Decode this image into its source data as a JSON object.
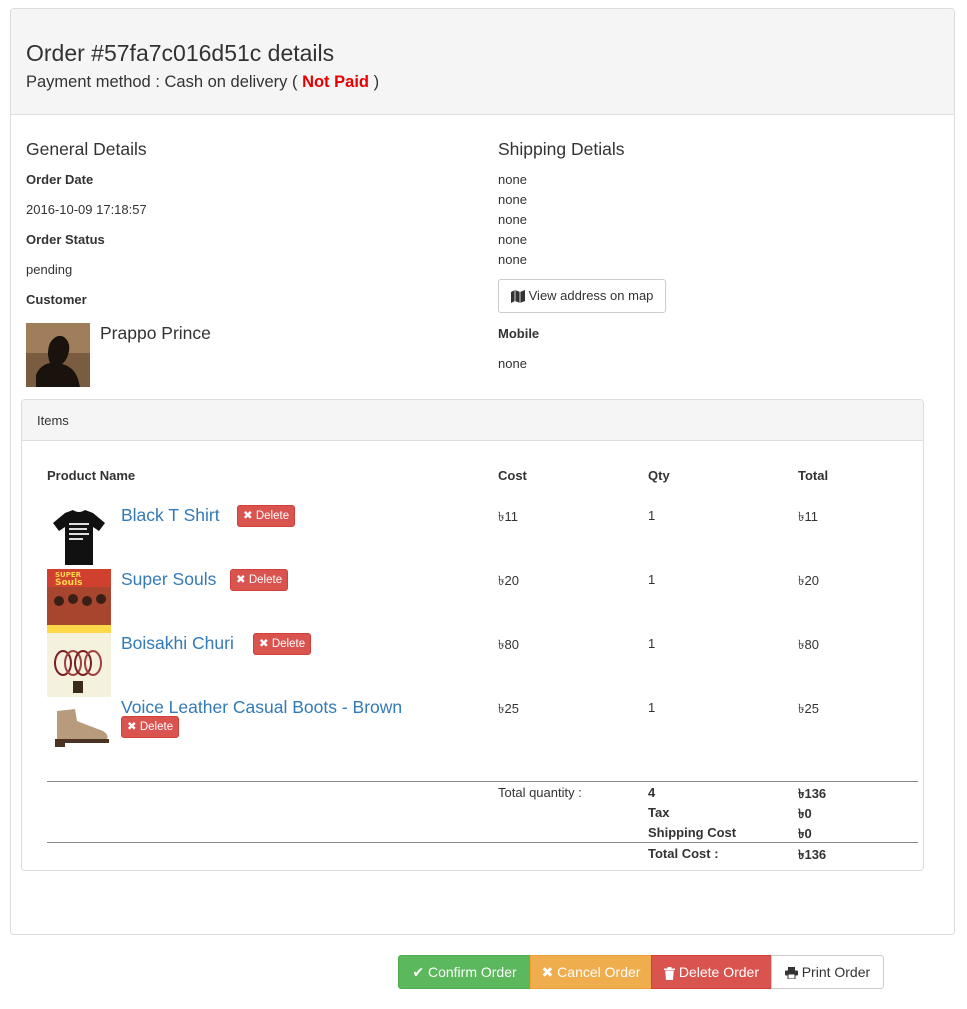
{
  "header": {
    "title": "Order #57fa7c016d51c details",
    "payment_prefix": "Payment method : Cash on delivery (",
    "payment_status": "Not Paid",
    "payment_suffix": ")"
  },
  "general": {
    "title": "General Details",
    "order_date_label": "Order Date",
    "order_date": "2016-10-09 17:18:57",
    "order_status_label": "Order Status",
    "order_status": "pending",
    "customer_label": "Customer",
    "customer_name": "Prappo Prince"
  },
  "shipping": {
    "title": "Shipping Detials",
    "lines": [
      "none",
      "none",
      "none",
      "none",
      "none"
    ],
    "map_button": "View address on map",
    "mobile_label": "Mobile",
    "mobile": "none"
  },
  "items": {
    "heading": "Items",
    "columns": [
      "Product Name",
      "Cost",
      "Qty",
      "Total"
    ],
    "delete_label": "Delete",
    "rows": [
      {
        "name": "Black T Shirt",
        "cost": "৳11",
        "qty": "1",
        "total": "৳11"
      },
      {
        "name": "Super Souls",
        "cost": "৳20",
        "qty": "1",
        "total": "৳20"
      },
      {
        "name": "Boisakhi Churi",
        "cost": "৳80",
        "qty": "1",
        "total": "৳80"
      },
      {
        "name": "Voice Leather Casual Boots - Brown",
        "cost": "৳25",
        "qty": "1",
        "total": "৳25"
      }
    ],
    "summary": {
      "total_quantity_label": "Total quantity :",
      "total_quantity": "4",
      "subtotal": "৳136",
      "tax_label": "Tax",
      "tax": "৳0",
      "shipping_label": "Shipping Cost",
      "shipping": "৳0",
      "total_cost_label": "Total Cost :",
      "total_cost": "৳136"
    }
  },
  "actions": {
    "confirm": "Confirm Order",
    "cancel": "Cancel Order",
    "delete": "Delete Order",
    "print": "Print Order"
  },
  "colors": {
    "link": "#337ab7",
    "not_paid": "#e60000",
    "success": "#5cb85c",
    "warning": "#f0ad4e",
    "danger": "#d9534f"
  }
}
